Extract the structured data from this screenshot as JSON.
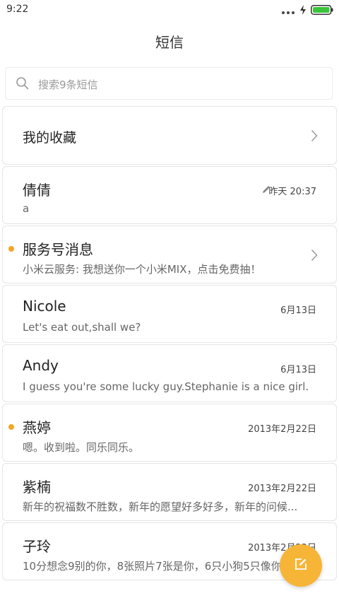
{
  "status_bar": {
    "time": "9:22"
  },
  "header": {
    "title": "短信"
  },
  "search": {
    "placeholder": "搜索9条短信"
  },
  "favorites": {
    "label": "我的收藏"
  },
  "conversations": [
    {
      "name": "倩倩",
      "snippet": "a",
      "date": "昨天 20:37",
      "draft": true,
      "unread": false
    },
    {
      "name": "服务号消息",
      "snippet": "小米云服务: 我想送你一个小米MIX，点击免费抽！",
      "date": "",
      "unread": true,
      "chevron": true
    },
    {
      "name": "Nicole",
      "snippet": "Let's eat out,shall we?",
      "date": "6月13日",
      "unread": false
    },
    {
      "name": "Andy",
      "snippet": "I guess you're some lucky guy.Stephanie is a nice girl.",
      "date": "6月13日",
      "unread": false
    },
    {
      "name": "燕婷",
      "snippet": "嗯。收到啦。同乐同乐。",
      "date": "2013年2月22日",
      "unread": true
    },
    {
      "name": "紫楠",
      "snippet": "新年的祝福数不胜数，新年的愿望好多好多，新年的问候...",
      "date": "2013年2月22日",
      "unread": false
    },
    {
      "name": "子玲",
      "snippet": "10分想念9别的你，8张照片7张是你，6只小狗5只像你",
      "date": "2013年2月22日",
      "unread": false
    }
  ],
  "colors": {
    "accent": "#f7b538",
    "unread_dot": "#f5a623",
    "battery": "#3cc43c"
  },
  "icons": {
    "search": "search-icon",
    "chevron": "chevron-right-icon",
    "draft": "pencil-icon",
    "compose": "compose-icon"
  }
}
